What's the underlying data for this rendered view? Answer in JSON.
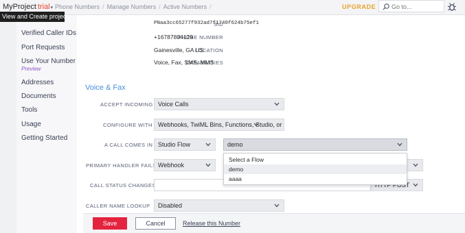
{
  "brand": {
    "name": "MyProject",
    "tag": "trial"
  },
  "breadcrumbs": [
    "Phone Numbers",
    "Manage Numbers",
    "Active Numbers"
  ],
  "upgrade_label": "UPGRADE",
  "search": {
    "placeholder": "Go to..."
  },
  "tooltip": "View and Create projects",
  "sidebar": {
    "items": [
      {
        "label": "Verified Caller IDs"
      },
      {
        "label": "Port Requests"
      },
      {
        "label": "Use Your Number",
        "sub": "Preview"
      },
      {
        "label": "Addresses"
      },
      {
        "label": "Documents"
      },
      {
        "label": "Tools"
      },
      {
        "label": "Usage"
      },
      {
        "label": "Getting Started"
      }
    ]
  },
  "properties": {
    "sid": {
      "label": "SID",
      "value": "PNaa3cc65277f932ad7f1740f624b75ef1"
    },
    "phone": {
      "label": "PHONE NUMBER",
      "value": "+16787804129"
    },
    "location": {
      "label": "LOCATION",
      "value": "Gainesville, GA US"
    },
    "capabilities": {
      "label": "CAPABILITIES",
      "value": "Voice, Fax, SMS, MMS"
    }
  },
  "voice_fax": {
    "title": "Voice & Fax",
    "accept_incoming": {
      "label": "ACCEPT INCOMING",
      "value": "Voice Calls"
    },
    "configure_with": {
      "label": "CONFIGURE WITH",
      "value": "Webhooks, TwiML Bins, Functions, Studio, or Proxy"
    },
    "call_comes_in": {
      "label": "A CALL COMES IN",
      "type_value": "Studio Flow",
      "flow_value": "demo"
    },
    "primary_handler_fails": {
      "label": "PRIMARY HANDLER FAILS",
      "value": "Webhook"
    },
    "call_status_changes": {
      "label": "CALL STATUS CHANGES",
      "method_value": "HTTP POST"
    },
    "caller_name_lookup": {
      "label": "CALLER NAME LOOKUP",
      "value": "Disabled"
    }
  },
  "flow_dropdown": {
    "options": [
      "Select a Flow",
      "demo",
      "aaaa"
    ],
    "highlighted_index": 1
  },
  "footer": {
    "save_label": "Save",
    "cancel_label": "Cancel",
    "release_label": "Release this Number"
  },
  "colors": {
    "accent_blue": "#4a90d9",
    "save_red": "#e4243f",
    "trial_red": "#e6442e",
    "upgrade_gold": "#e8a42b",
    "preview_purple": "#8a55c8"
  }
}
